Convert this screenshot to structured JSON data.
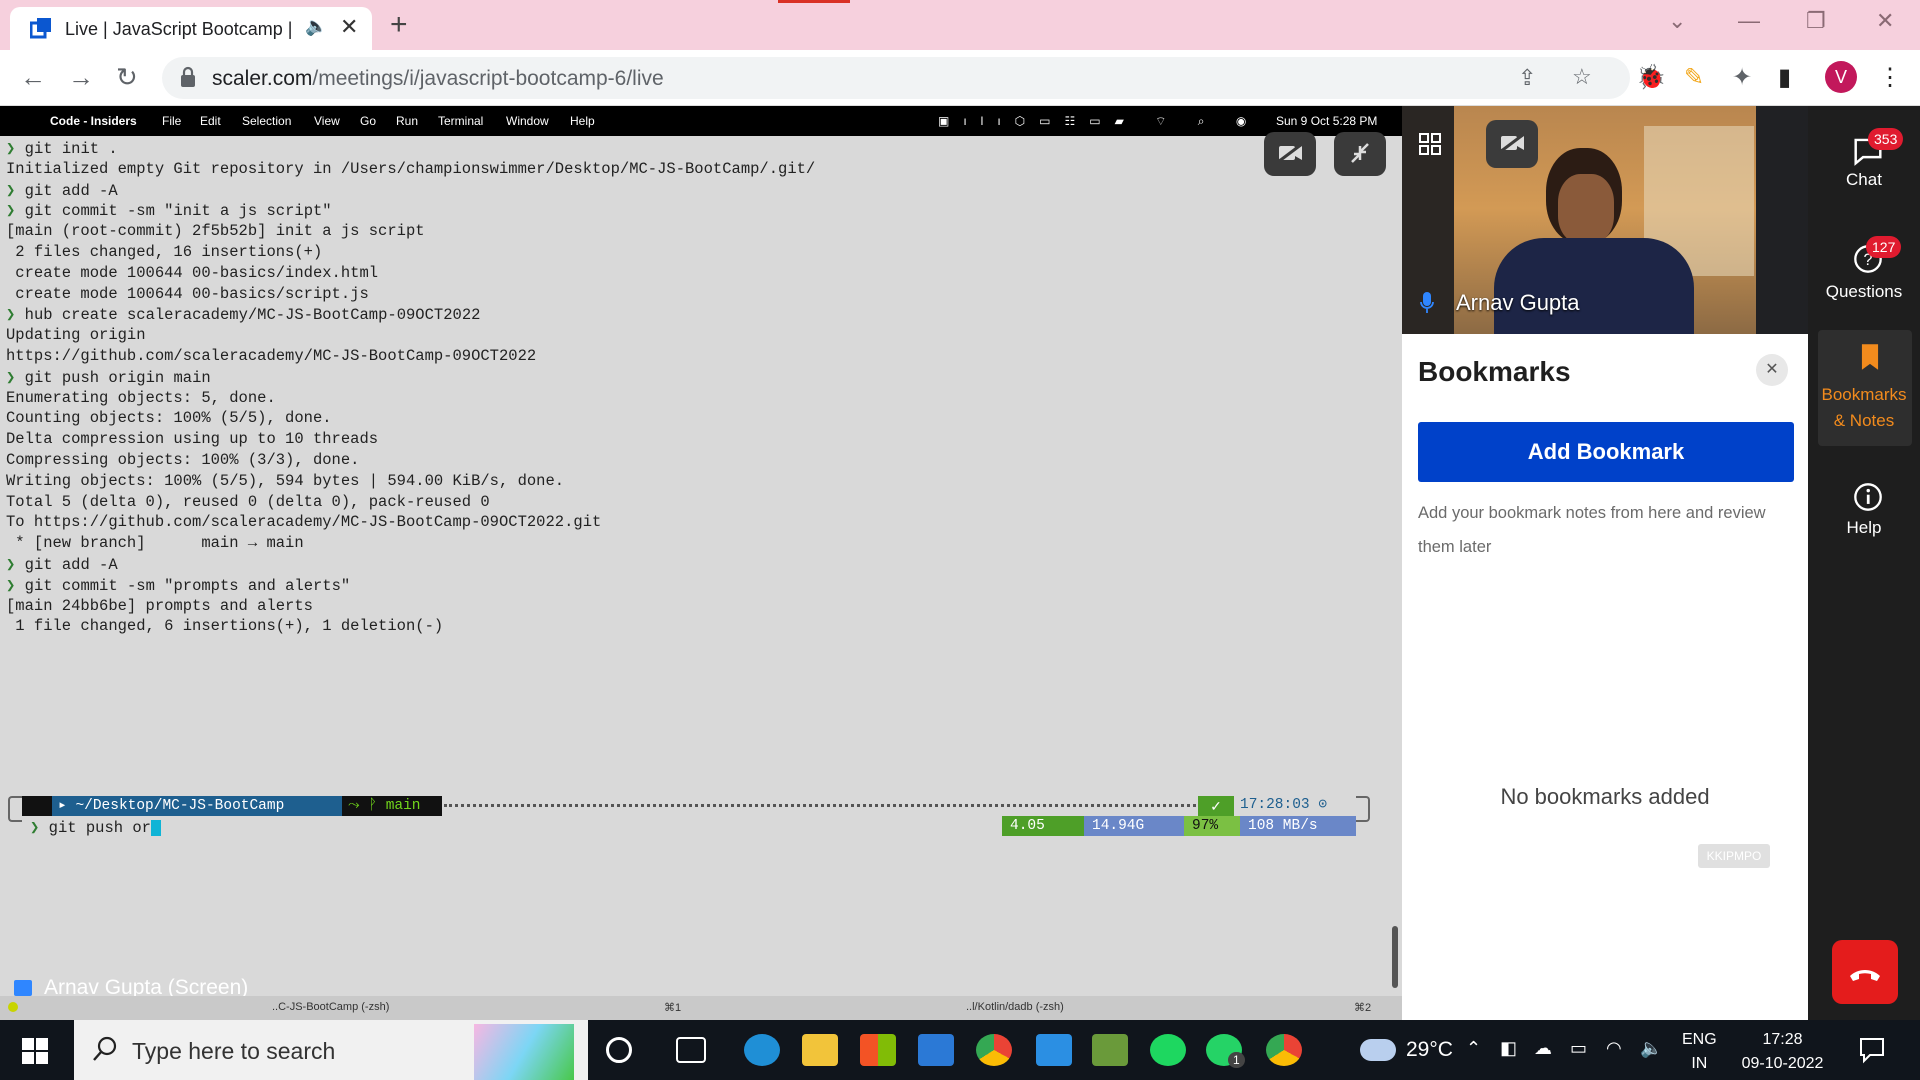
{
  "browser": {
    "tab_title": "Live | JavaScript Bootcamp | S",
    "url_host": "scaler.com",
    "url_path": "/meetings/i/javascript-bootcamp-6/live",
    "profile_initial": "V"
  },
  "screen_share": {
    "menubar": {
      "app": "Code - Insiders",
      "items": [
        "File",
        "Edit",
        "Selection",
        "View",
        "Go",
        "Run",
        "Terminal",
        "Window",
        "Help"
      ],
      "datetime": "Sun 9 Oct  5:28 PM"
    },
    "terminal_lines": [
      {
        "chev": "❯",
        "text": " git init ."
      },
      {
        "chev": "",
        "text": "Initialized empty Git repository in /Users/championswimmer/Desktop/MC-JS-BootCamp/.git/"
      },
      {
        "chev": "❯",
        "text": " git add -A"
      },
      {
        "chev": "❯",
        "text": " git commit -sm \"init a js script\""
      },
      {
        "chev": "",
        "text": "[main (root-commit) 2f5b52b] init a js script"
      },
      {
        "chev": "",
        "text": " 2 files changed, 16 insertions(+)"
      },
      {
        "chev": "",
        "text": " create mode 100644 00-basics/index.html"
      },
      {
        "chev": "",
        "text": " create mode 100644 00-basics/script.js"
      },
      {
        "chev": "❯",
        "text": " hub create scaleracademy/MC-JS-BootCamp-09OCT2022"
      },
      {
        "chev": "",
        "text": "Updating origin"
      },
      {
        "chev": "",
        "text": "https://github.com/scaleracademy/MC-JS-BootCamp-09OCT2022"
      },
      {
        "chev": "❯",
        "text": " git push origin main"
      },
      {
        "chev": "",
        "text": "Enumerating objects: 5, done."
      },
      {
        "chev": "",
        "text": "Counting objects: 100% (5/5), done."
      },
      {
        "chev": "",
        "text": "Delta compression using up to 10 threads"
      },
      {
        "chev": "",
        "text": "Compressing objects: 100% (3/3), done."
      },
      {
        "chev": "",
        "text": "Writing objects: 100% (5/5), 594 bytes | 594.00 KiB/s, done."
      },
      {
        "chev": "",
        "text": "Total 5 (delta 0), reused 0 (delta 0), pack-reused 0"
      },
      {
        "chev": "",
        "text": "To https://github.com/scaleracademy/MC-JS-BootCamp-09OCT2022.git"
      },
      {
        "chev": "",
        "text": " * [new branch]      main → main"
      },
      {
        "chev": "❯",
        "text": " git add -A"
      },
      {
        "chev": "❯",
        "text": " git commit -sm \"prompts and alerts\""
      },
      {
        "chev": "",
        "text": "[main 24bb6be] prompts and alerts"
      },
      {
        "chev": "",
        "text": " 1 file changed, 6 insertions(+), 1 deletion(-)"
      }
    ],
    "prompt": {
      "path": "~/Desktop/MC-JS-BootCamp",
      "branch": "main",
      "time": "17:28:03",
      "current_command": "git push or",
      "stats": [
        "4.05",
        "14.94G",
        "97%",
        "108 MB/s"
      ]
    },
    "presenter_label": "Arnav Gupta (Screen)",
    "bottom_tabs": [
      "..C-JS-BootCamp (-zsh)",
      "⌘1",
      "..l/Kotlin/dadb (-zsh)",
      "⌘2"
    ]
  },
  "video": {
    "participant": "Arnav Gupta"
  },
  "bookmarks": {
    "title": "Bookmarks",
    "add_button": "Add Bookmark",
    "hint": "Add your bookmark notes from here and review them later",
    "empty_state": "No bookmarks added",
    "code": "KKIPMPO"
  },
  "sidebar": {
    "chat": {
      "label": "Chat",
      "badge": "353"
    },
    "questions": {
      "label": "Questions",
      "badge": "127"
    },
    "bookmarks": {
      "label_line1": "Bookmarks",
      "label_line2": "& Notes"
    },
    "help": {
      "label": "Help"
    }
  },
  "taskbar": {
    "search_placeholder": "Type here to search",
    "weather": "29°C",
    "lang_line1": "ENG",
    "lang_line2": "IN",
    "time": "17:28",
    "date": "09-10-2022",
    "whatsapp_badge": "1"
  },
  "colors": {
    "accent_blue": "#0041c9",
    "end_call": "#e41c1c",
    "badge_red": "#e01b2f"
  }
}
